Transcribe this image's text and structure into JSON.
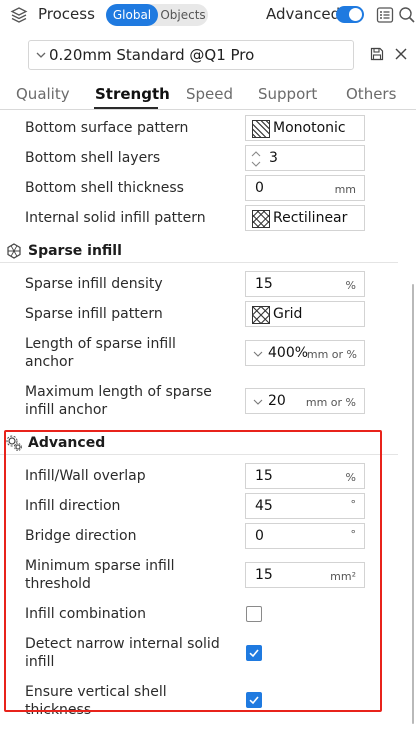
{
  "header": {
    "title": "Process",
    "scope_global": "Global",
    "scope_objects": "Objects",
    "advanced_label": "Advanced",
    "advanced_on": true,
    "accent_color": "#1f7ae0"
  },
  "preset": {
    "name": "0.20mm Standard @Q1 Pro",
    "icons": [
      "chevron-down-icon",
      "save-icon",
      "close-icon"
    ]
  },
  "tabs": [
    {
      "label": "Quality",
      "active": false
    },
    {
      "label": "Strength",
      "active": true
    },
    {
      "label": "Speed",
      "active": false
    },
    {
      "label": "Support",
      "active": false
    },
    {
      "label": "Others",
      "active": false
    }
  ],
  "walls": {
    "bottom_surface_pattern": {
      "label": "Bottom surface pattern",
      "value": "Monotonic",
      "icon": "monotonic-pattern-icon"
    },
    "bottom_shell_layers": {
      "label": "Bottom shell layers",
      "value": "3"
    },
    "bottom_shell_thickness": {
      "label": "Bottom shell thickness",
      "value": "0",
      "unit": "mm"
    },
    "internal_solid_infill_pattern": {
      "label": "Internal solid infill pattern",
      "value": "Rectilinear",
      "icon": "rectilinear-pattern-icon"
    }
  },
  "sparse": {
    "title": "Sparse infill",
    "density": {
      "label": "Sparse infill density",
      "value": "15",
      "unit": "%"
    },
    "pattern": {
      "label": "Sparse infill pattern",
      "value": "Grid",
      "icon": "grid-pattern-icon"
    },
    "anchor_line1": "Length of sparse infill",
    "anchor_line2": "anchor",
    "anchor": {
      "value": "400%",
      "unit": "mm or %"
    },
    "max_anchor_line1": "Maximum length of sparse",
    "max_anchor_line2": "infill anchor",
    "max_anchor": {
      "value": "20",
      "unit": "mm or %"
    }
  },
  "advanced": {
    "title": "Advanced",
    "infill_wall_overlap": {
      "label": "Infill/Wall overlap",
      "value": "15",
      "unit": "%"
    },
    "infill_direction": {
      "label": "Infill direction",
      "value": "45",
      "unit": "°"
    },
    "bridge_direction": {
      "label": "Bridge direction",
      "value": "0",
      "unit": "°"
    },
    "min_sparse_line1": "Minimum sparse infill",
    "min_sparse_line2": "threshold",
    "min_sparse": {
      "value": "15",
      "unit": "mm²"
    },
    "infill_combination": {
      "label": "Infill combination",
      "checked": false
    },
    "detect_narrow_line1": "Detect narrow internal solid",
    "detect_narrow_line2": "infill",
    "detect_narrow_checked": true,
    "ensure_vertical_line1": "Ensure vertical shell",
    "ensure_vertical_line2": "thickness",
    "ensure_vertical_checked": true,
    "highlight_color": "#e8231b"
  }
}
